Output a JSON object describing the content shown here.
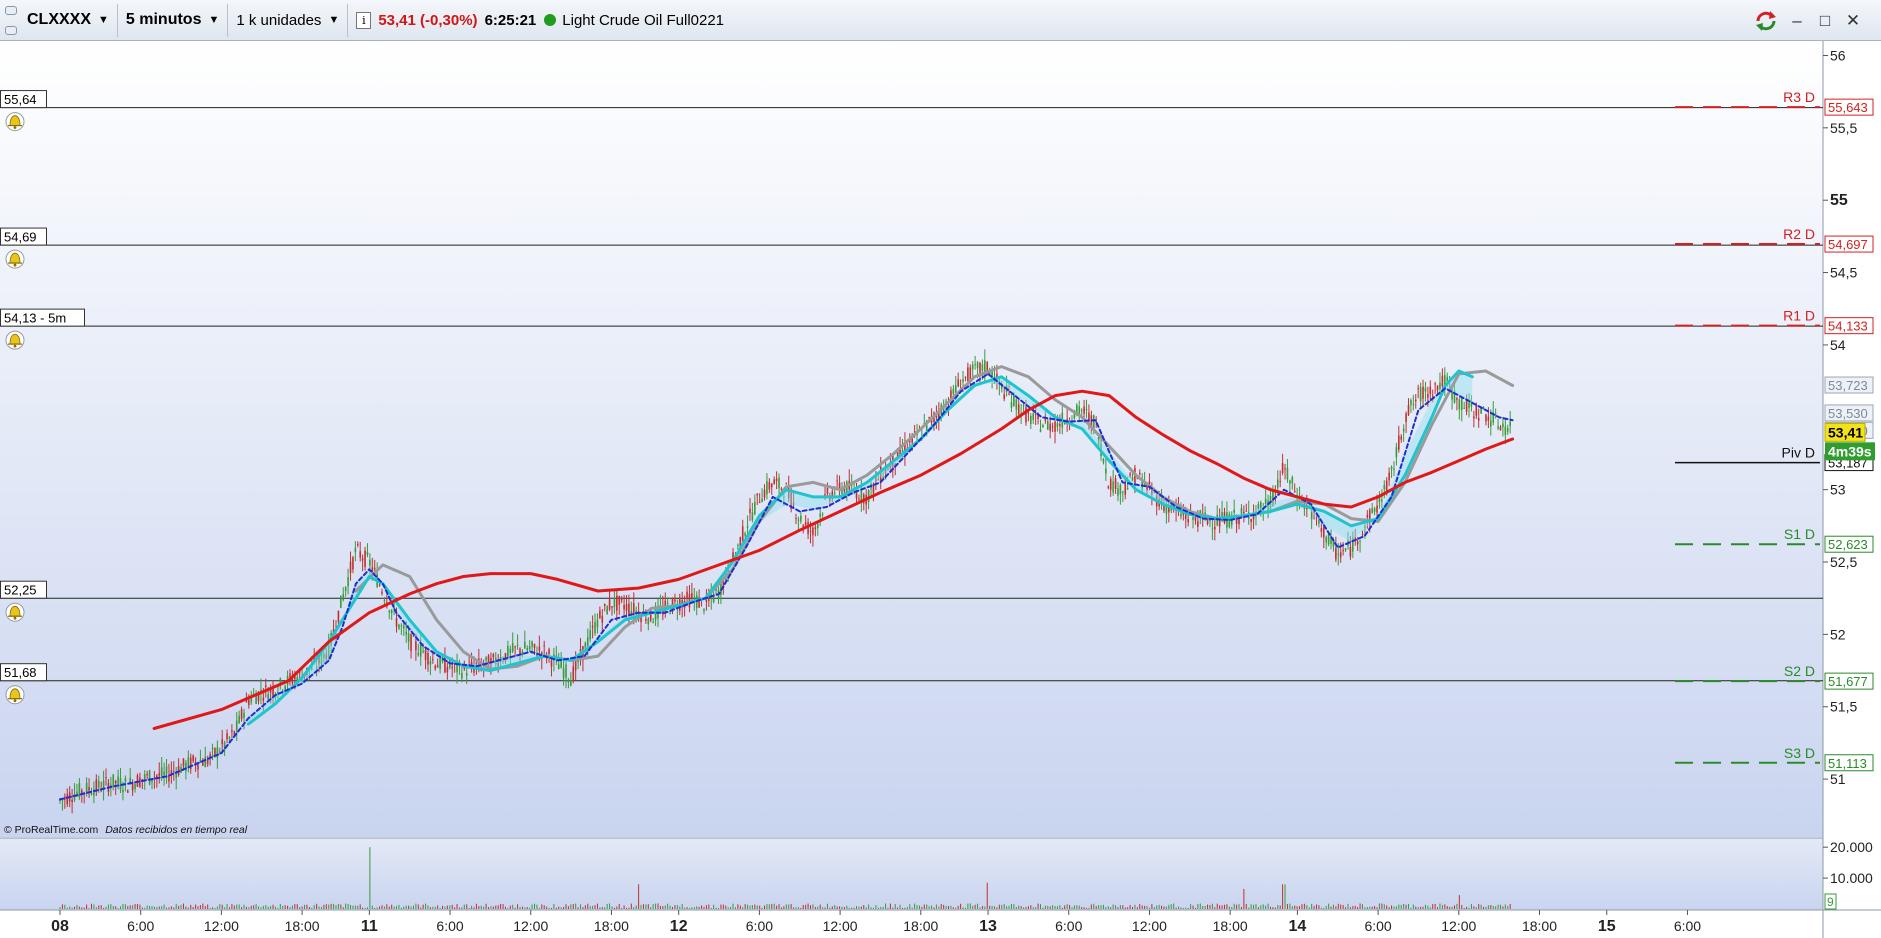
{
  "toolbar": {
    "symbol": "CLXXXX",
    "timeframe": "5 minutos",
    "units": "1 k unidades",
    "price_change": "53,41 (-0,30%)",
    "time": "6:25:21",
    "instrument": "Light Crude Oil Full0221"
  },
  "window": {
    "minimize": "–",
    "maximize": "□",
    "close": "✕"
  },
  "chart_data": {
    "type": "line",
    "x_labels": [
      {
        "t": 0,
        "label": "08",
        "bold": true
      },
      {
        "t": 6,
        "label": "6:00"
      },
      {
        "t": 12,
        "label": "12:00"
      },
      {
        "t": 18,
        "label": "18:00"
      },
      {
        "t": 23,
        "label": "11",
        "bold": true
      },
      {
        "t": 29,
        "label": "6:00"
      },
      {
        "t": 35,
        "label": "12:00"
      },
      {
        "t": 41,
        "label": "18:00"
      },
      {
        "t": 46,
        "label": "12",
        "bold": true
      },
      {
        "t": 52,
        "label": "6:00"
      },
      {
        "t": 58,
        "label": "12:00"
      },
      {
        "t": 64,
        "label": "18:00"
      },
      {
        "t": 69,
        "label": "13",
        "bold": true
      },
      {
        "t": 75,
        "label": "6:00"
      },
      {
        "t": 81,
        "label": "12:00"
      },
      {
        "t": 87,
        "label": "18:00"
      },
      {
        "t": 92,
        "label": "14",
        "bold": true
      },
      {
        "t": 98,
        "label": "6:00"
      },
      {
        "t": 104,
        "label": "12:00"
      },
      {
        "t": 110,
        "label": "18:00"
      },
      {
        "t": 115,
        "label": "15",
        "bold": true
      },
      {
        "t": 121,
        "label": "6:00"
      }
    ],
    "y_ticks": [
      {
        "v": 56,
        "label": "56"
      },
      {
        "v": 55.5,
        "label": "55,5"
      },
      {
        "v": 55,
        "label": "55",
        "bold": true
      },
      {
        "v": 54.5,
        "label": "54,5"
      },
      {
        "v": 54,
        "label": "54"
      },
      {
        "v": 53,
        "label": "53"
      },
      {
        "v": 52.5,
        "label": "52,5"
      },
      {
        "v": 52,
        "label": "52"
      },
      {
        "v": 51.5,
        "label": "51,5"
      },
      {
        "v": 51,
        "label": "51"
      }
    ],
    "y_range": [
      50.6,
      56.1
    ],
    "horizontal_lines": [
      {
        "v": 55.64,
        "label": "55,64"
      },
      {
        "v": 54.69,
        "label": "54,69"
      },
      {
        "v": 54.13,
        "label": "54,13 - 5m"
      },
      {
        "v": 52.25,
        "label": "52,25"
      },
      {
        "v": 51.68,
        "label": "51,68"
      }
    ],
    "pivots": [
      {
        "name": "R3 D",
        "value": "55,643",
        "v": 55.643,
        "color": "#d42020",
        "dash": true
      },
      {
        "name": "R2 D",
        "value": "54,697",
        "v": 54.697,
        "color": "#d42020",
        "dash": true
      },
      {
        "name": "R1 D",
        "value": "54,133",
        "v": 54.133,
        "color": "#d42020",
        "dash": true
      },
      {
        "name": "Piv D",
        "value": "53,187",
        "v": 53.187,
        "color": "#111111",
        "dash": false
      },
      {
        "name": "S1 D",
        "value": "52,623",
        "v": 52.623,
        "color": "#2a8a2a",
        "dash": true
      },
      {
        "name": "S2 D",
        "value": "51,677",
        "v": 51.677,
        "color": "#2a8a2a",
        "dash": true
      },
      {
        "name": "S3 D",
        "value": "51,113",
        "v": 51.113,
        "color": "#2a8a2a",
        "dash": true
      }
    ],
    "right_labels": [
      {
        "v": 53.723,
        "label": "53,723"
      },
      {
        "v": 53.53,
        "label": "53,530"
      },
      {
        "v": 53.41,
        "label": "53,410"
      }
    ],
    "last_price": {
      "v": 53.41,
      "label": "53,41",
      "countdown": "4m39s"
    },
    "price_series": [
      [
        0,
        50.85
      ],
      [
        1,
        50.9
      ],
      [
        2,
        50.93
      ],
      [
        3,
        50.95
      ],
      [
        4,
        50.98
      ],
      [
        5,
        50.96
      ],
      [
        6,
        51.0
      ],
      [
        7,
        51.02
      ],
      [
        8,
        51.03
      ],
      [
        9,
        51.08
      ],
      [
        10,
        51.12
      ],
      [
        11,
        51.13
      ],
      [
        12,
        51.22
      ],
      [
        13,
        51.32
      ],
      [
        14,
        51.55
      ],
      [
        15,
        51.6
      ],
      [
        16,
        51.62
      ],
      [
        17,
        51.68
      ],
      [
        18,
        51.72
      ],
      [
        19,
        51.78
      ],
      [
        20,
        51.9
      ],
      [
        21,
        52.25
      ],
      [
        22,
        52.58
      ],
      [
        23,
        52.5
      ],
      [
        24,
        52.3
      ],
      [
        25,
        52.1
      ],
      [
        26,
        51.95
      ],
      [
        27,
        51.88
      ],
      [
        28,
        51.8
      ],
      [
        29,
        51.78
      ],
      [
        30,
        51.75
      ],
      [
        31,
        51.78
      ],
      [
        32,
        51.8
      ],
      [
        33,
        51.85
      ],
      [
        34,
        51.9
      ],
      [
        35,
        51.9
      ],
      [
        36,
        51.88
      ],
      [
        37,
        51.8
      ],
      [
        38,
        51.7
      ],
      [
        39,
        51.9
      ],
      [
        40,
        52.1
      ],
      [
        41,
        52.22
      ],
      [
        42,
        52.2
      ],
      [
        43,
        52.15
      ],
      [
        44,
        52.12
      ],
      [
        45,
        52.18
      ],
      [
        46,
        52.22
      ],
      [
        47,
        52.25
      ],
      [
        48,
        52.2
      ],
      [
        49,
        52.3
      ],
      [
        50,
        52.5
      ],
      [
        51,
        52.75
      ],
      [
        52,
        52.95
      ],
      [
        53,
        53.05
      ],
      [
        54,
        53.0
      ],
      [
        55,
        52.8
      ],
      [
        56,
        52.7
      ],
      [
        57,
        52.95
      ],
      [
        58,
        53.02
      ],
      [
        59,
        53.0
      ],
      [
        60,
        52.95
      ],
      [
        61,
        53.1
      ],
      [
        62,
        53.2
      ],
      [
        63,
        53.3
      ],
      [
        64,
        53.4
      ],
      [
        65,
        53.5
      ],
      [
        66,
        53.6
      ],
      [
        67,
        53.75
      ],
      [
        68,
        53.82
      ],
      [
        69,
        53.85
      ],
      [
        70,
        53.7
      ],
      [
        71,
        53.6
      ],
      [
        72,
        53.5
      ],
      [
        73,
        53.45
      ],
      [
        74,
        53.45
      ],
      [
        75,
        53.5
      ],
      [
        76,
        53.55
      ],
      [
        77,
        53.45
      ],
      [
        78,
        53.05
      ],
      [
        79,
        53.0
      ],
      [
        80,
        53.1
      ],
      [
        81,
        53.0
      ],
      [
        82,
        52.9
      ],
      [
        83,
        52.85
      ],
      [
        84,
        52.8
      ],
      [
        85,
        52.8
      ],
      [
        86,
        52.78
      ],
      [
        87,
        52.8
      ],
      [
        88,
        52.82
      ],
      [
        89,
        52.85
      ],
      [
        90,
        52.9
      ],
      [
        91,
        53.15
      ],
      [
        92,
        52.95
      ],
      [
        93,
        52.85
      ],
      [
        94,
        52.7
      ],
      [
        95,
        52.55
      ],
      [
        96,
        52.6
      ],
      [
        97,
        52.75
      ],
      [
        98,
        52.9
      ],
      [
        99,
        53.1
      ],
      [
        100,
        53.5
      ],
      [
        101,
        53.65
      ],
      [
        102,
        53.7
      ],
      [
        103,
        53.75
      ],
      [
        104,
        53.6
      ],
      [
        105,
        53.55
      ],
      [
        106,
        53.52
      ],
      [
        107,
        53.45
      ],
      [
        108,
        53.41
      ]
    ],
    "dashed_series": [
      [
        0,
        50.86
      ],
      [
        4,
        50.95
      ],
      [
        8,
        51.02
      ],
      [
        12,
        51.18
      ],
      [
        14,
        51.42
      ],
      [
        16,
        51.58
      ],
      [
        18,
        51.66
      ],
      [
        20,
        51.82
      ],
      [
        21,
        52.05
      ],
      [
        22,
        52.35
      ],
      [
        23,
        52.45
      ],
      [
        24,
        52.35
      ],
      [
        25,
        52.15
      ],
      [
        27,
        51.92
      ],
      [
        29,
        51.8
      ],
      [
        31,
        51.78
      ],
      [
        33,
        51.83
      ],
      [
        35,
        51.88
      ],
      [
        37,
        51.82
      ],
      [
        39,
        51.85
      ],
      [
        41,
        52.1
      ],
      [
        43,
        52.15
      ],
      [
        45,
        52.15
      ],
      [
        47,
        52.22
      ],
      [
        49,
        52.28
      ],
      [
        51,
        52.6
      ],
      [
        53,
        52.95
      ],
      [
        55,
        52.85
      ],
      [
        57,
        52.88
      ],
      [
        59,
        52.98
      ],
      [
        61,
        53.05
      ],
      [
        63,
        53.25
      ],
      [
        65,
        53.45
      ],
      [
        67,
        53.68
      ],
      [
        69,
        53.8
      ],
      [
        71,
        53.65
      ],
      [
        73,
        53.5
      ],
      [
        75,
        53.47
      ],
      [
        77,
        53.48
      ],
      [
        79,
        53.05
      ],
      [
        81,
        53.02
      ],
      [
        83,
        52.88
      ],
      [
        85,
        52.8
      ],
      [
        87,
        52.79
      ],
      [
        89,
        52.83
      ],
      [
        91,
        53.0
      ],
      [
        93,
        52.9
      ],
      [
        95,
        52.6
      ],
      [
        97,
        52.68
      ],
      [
        99,
        52.95
      ],
      [
        101,
        53.55
      ],
      [
        103,
        53.7
      ],
      [
        105,
        53.6
      ],
      [
        107,
        53.5
      ],
      [
        108,
        53.48
      ]
    ],
    "ma_red": [
      [
        7,
        51.35
      ],
      [
        12,
        51.48
      ],
      [
        17,
        51.68
      ],
      [
        20,
        51.95
      ],
      [
        23,
        52.15
      ],
      [
        26,
        52.28
      ],
      [
        28,
        52.35
      ],
      [
        30,
        52.4
      ],
      [
        32,
        52.42
      ],
      [
        35,
        52.42
      ],
      [
        37,
        52.38
      ],
      [
        40,
        52.3
      ],
      [
        43,
        52.32
      ],
      [
        46,
        52.38
      ],
      [
        49,
        52.48
      ],
      [
        52,
        52.58
      ],
      [
        55,
        52.72
      ],
      [
        58,
        52.85
      ],
      [
        61,
        52.98
      ],
      [
        64,
        53.1
      ],
      [
        67,
        53.25
      ],
      [
        70,
        53.42
      ],
      [
        72,
        53.55
      ],
      [
        74,
        53.65
      ],
      [
        76,
        53.68
      ],
      [
        78,
        53.65
      ],
      [
        80,
        53.5
      ],
      [
        82,
        53.38
      ],
      [
        84,
        53.27
      ],
      [
        86,
        53.18
      ],
      [
        88,
        53.08
      ],
      [
        90,
        53.0
      ],
      [
        92,
        52.95
      ],
      [
        94,
        52.9
      ],
      [
        96,
        52.88
      ],
      [
        98,
        52.95
      ],
      [
        100,
        53.05
      ],
      [
        102,
        53.12
      ],
      [
        104,
        53.2
      ],
      [
        106,
        53.28
      ],
      [
        108,
        53.35
      ]
    ],
    "ma_teal": [
      [
        14,
        51.38
      ],
      [
        16,
        51.52
      ],
      [
        18,
        51.7
      ],
      [
        20,
        51.95
      ],
      [
        22,
        52.25
      ],
      [
        23,
        52.4
      ],
      [
        24,
        52.35
      ],
      [
        26,
        52.1
      ],
      [
        28,
        51.88
      ],
      [
        30,
        51.78
      ],
      [
        32,
        51.75
      ],
      [
        34,
        51.8
      ],
      [
        36,
        51.85
      ],
      [
        38,
        51.82
      ],
      [
        40,
        51.95
      ],
      [
        42,
        52.1
      ],
      [
        44,
        52.15
      ],
      [
        46,
        52.2
      ],
      [
        48,
        52.25
      ],
      [
        50,
        52.5
      ],
      [
        52,
        52.82
      ],
      [
        54,
        53.0
      ],
      [
        56,
        52.95
      ],
      [
        58,
        52.95
      ],
      [
        60,
        53.05
      ],
      [
        62,
        53.2
      ],
      [
        64,
        53.35
      ],
      [
        66,
        53.55
      ],
      [
        68,
        53.72
      ],
      [
        70,
        53.78
      ],
      [
        72,
        53.65
      ],
      [
        74,
        53.5
      ],
      [
        76,
        53.42
      ],
      [
        78,
        53.2
      ],
      [
        80,
        53.0
      ],
      [
        82,
        52.9
      ],
      [
        84,
        52.83
      ],
      [
        86,
        52.8
      ],
      [
        88,
        52.82
      ],
      [
        90,
        52.85
      ],
      [
        92,
        52.9
      ],
      [
        94,
        52.85
      ],
      [
        96,
        52.75
      ],
      [
        98,
        52.8
      ],
      [
        100,
        53.1
      ],
      [
        102,
        53.5
      ],
      [
        103,
        53.72
      ],
      [
        104,
        53.82
      ],
      [
        105,
        53.78
      ]
    ],
    "ma_gray": [
      [
        22,
        52.3
      ],
      [
        24,
        52.48
      ],
      [
        26,
        52.4
      ],
      [
        28,
        52.1
      ],
      [
        30,
        51.88
      ],
      [
        32,
        51.76
      ],
      [
        34,
        51.78
      ],
      [
        36,
        51.85
      ],
      [
        38,
        51.82
      ],
      [
        40,
        51.85
      ],
      [
        42,
        52.05
      ],
      [
        44,
        52.18
      ],
      [
        46,
        52.2
      ],
      [
        48,
        52.25
      ],
      [
        50,
        52.45
      ],
      [
        52,
        52.78
      ],
      [
        54,
        53.02
      ],
      [
        56,
        53.05
      ],
      [
        58,
        53.0
      ],
      [
        60,
        53.1
      ],
      [
        62,
        53.25
      ],
      [
        64,
        53.42
      ],
      [
        66,
        53.6
      ],
      [
        68,
        53.78
      ],
      [
        70,
        53.85
      ],
      [
        72,
        53.78
      ],
      [
        74,
        53.62
      ],
      [
        76,
        53.5
      ],
      [
        78,
        53.3
      ],
      [
        80,
        53.1
      ],
      [
        82,
        52.95
      ],
      [
        84,
        52.85
      ],
      [
        86,
        52.8
      ],
      [
        88,
        52.82
      ],
      [
        90,
        52.85
      ],
      [
        92,
        52.92
      ],
      [
        94,
        52.9
      ],
      [
        96,
        52.8
      ],
      [
        98,
        52.78
      ],
      [
        100,
        53.05
      ],
      [
        102,
        53.45
      ],
      [
        104,
        53.8
      ],
      [
        106,
        53.82
      ],
      [
        108,
        53.72
      ]
    ],
    "volume_axis": [
      {
        "v": 20000,
        "label": "20.000"
      },
      {
        "v": 10000,
        "label": "10.000"
      }
    ],
    "volume_last": "9",
    "volume_range": [
      0,
      22000
    ],
    "volume_spikes": [
      [
        23,
        20000
      ],
      [
        43,
        8000
      ],
      [
        69,
        8500
      ],
      [
        88,
        6500
      ],
      [
        91,
        8000
      ],
      [
        104,
        4500
      ],
      [
        113,
        7000
      ]
    ],
    "footer": {
      "source": "© ProRealTime.com",
      "note": "Datos recibidos en tiempo real"
    }
  }
}
